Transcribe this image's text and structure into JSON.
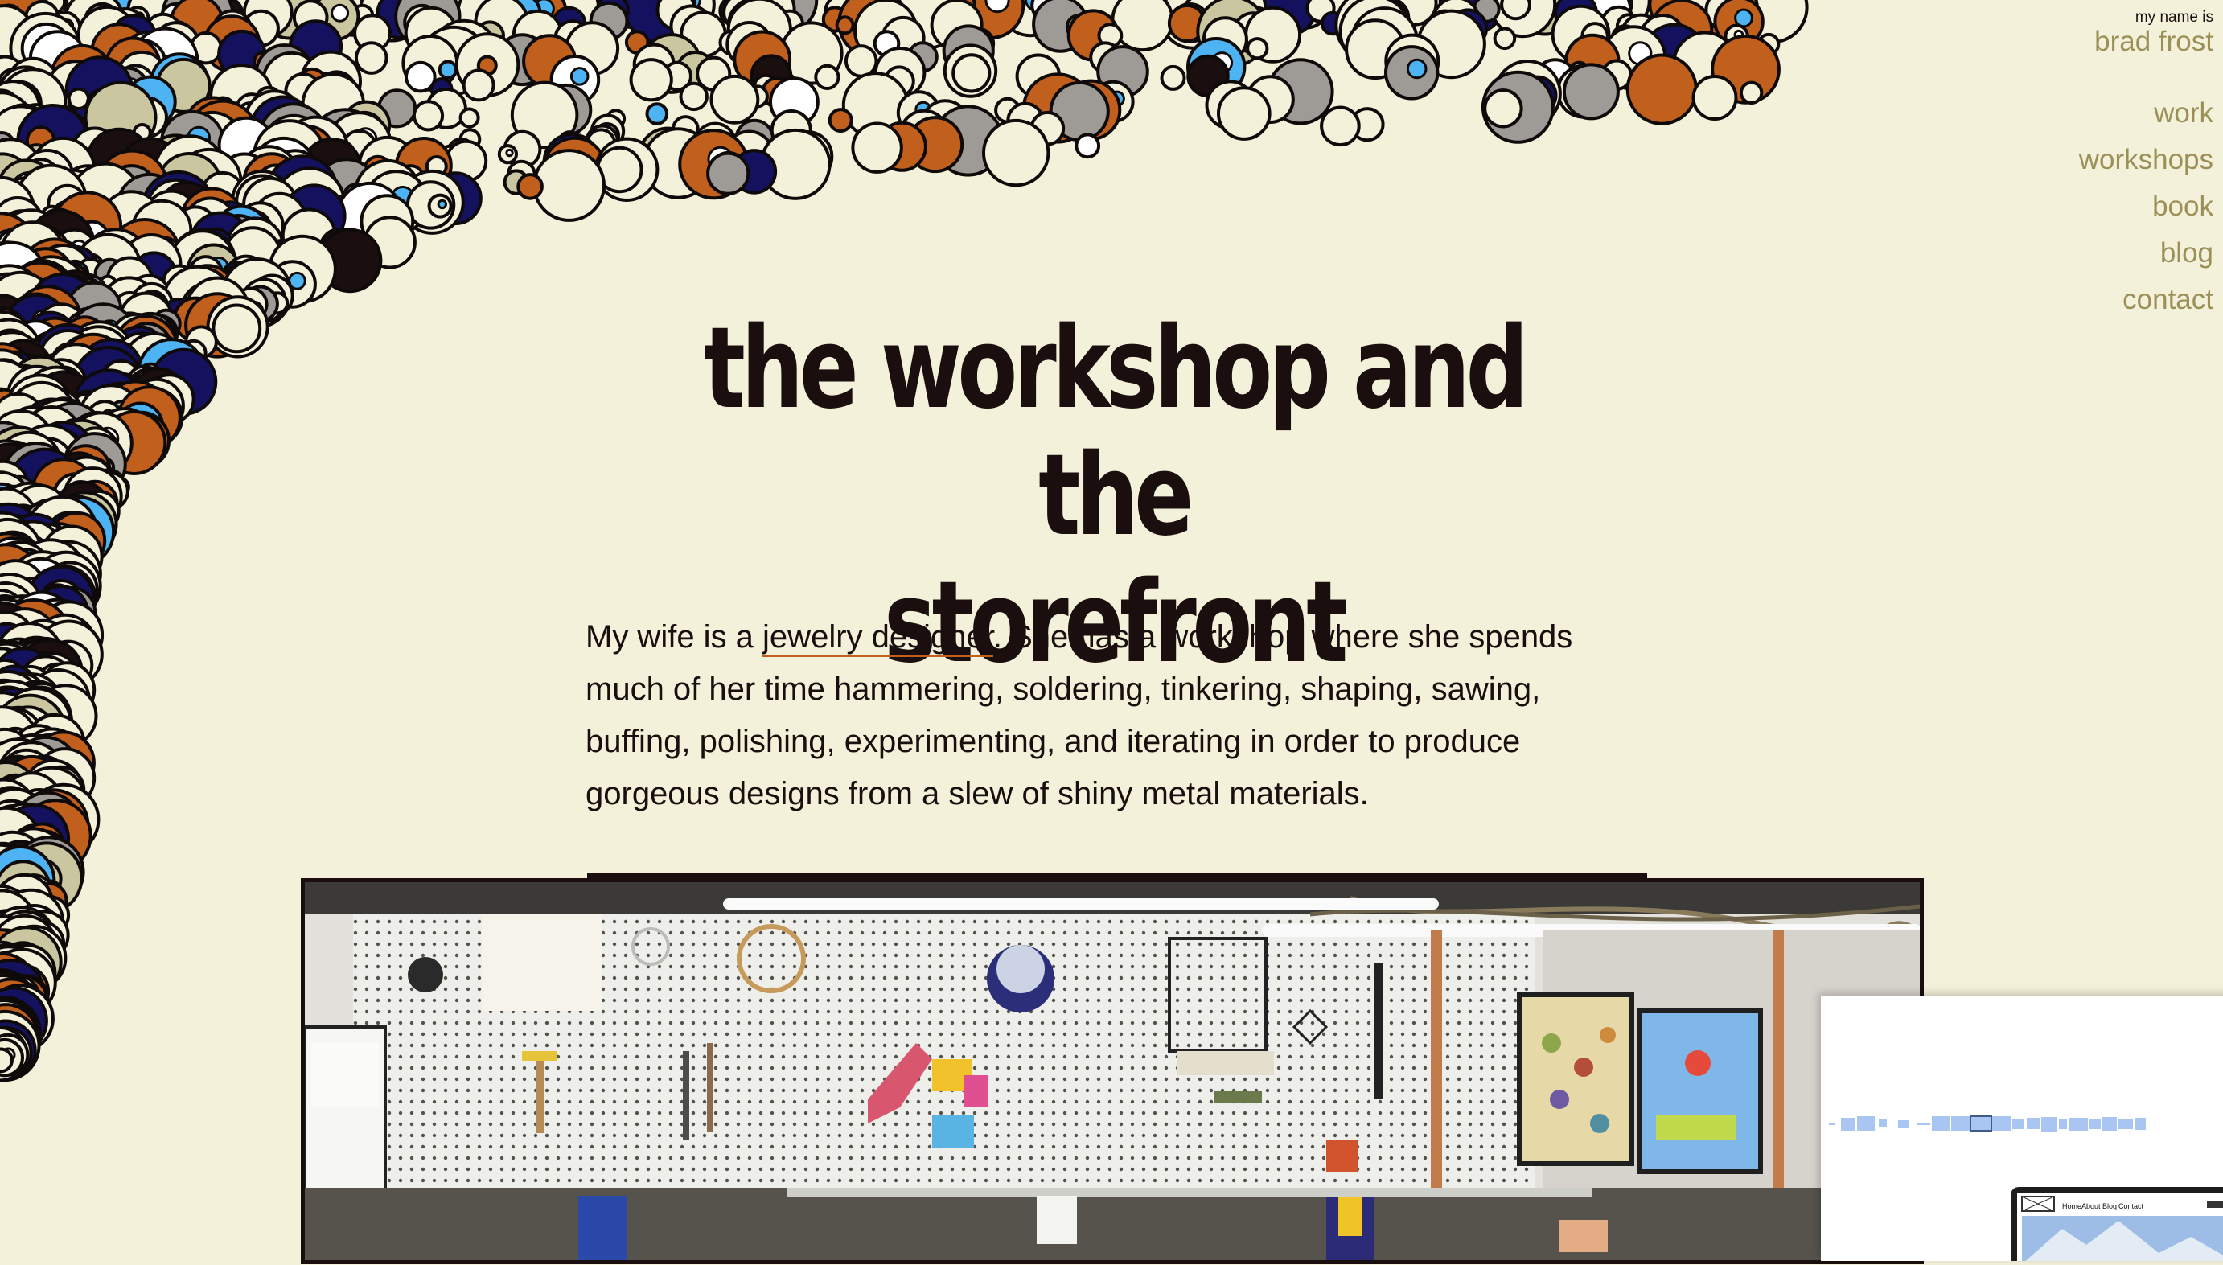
{
  "header": {
    "intro_small": "my name is",
    "name": "brad frost"
  },
  "nav": {
    "items": [
      "work",
      "workshops",
      "book",
      "blog",
      "contact"
    ]
  },
  "article": {
    "title_line1": "the workshop and the",
    "title_line2": "storefront",
    "intro_before_link": "My wife is a ",
    "intro_link": "jewelry designer",
    "intro_after_link": ". She has a workshop where she spends much of her time hammering, soldering, tinkering, shaping, sawing, buffing, polishing, experimenting, and iterating in order to produce gorgeous designs from a slew of shiny metal materials."
  },
  "overlay_site": {
    "nav_items": [
      "Home",
      "About",
      "Blog",
      "Contact"
    ]
  },
  "colors": {
    "background": "#f4f1da",
    "nav_text": "#9b9158",
    "heading": "#1a0e0e",
    "link_underline": "#c15f1d",
    "bubble_colors": [
      "#f4f1da",
      "#c15f1d",
      "#14125e",
      "#9e9a96",
      "#c9c6a0",
      "#4db3f2",
      "#1a0e0e",
      "#ffffff"
    ]
  }
}
